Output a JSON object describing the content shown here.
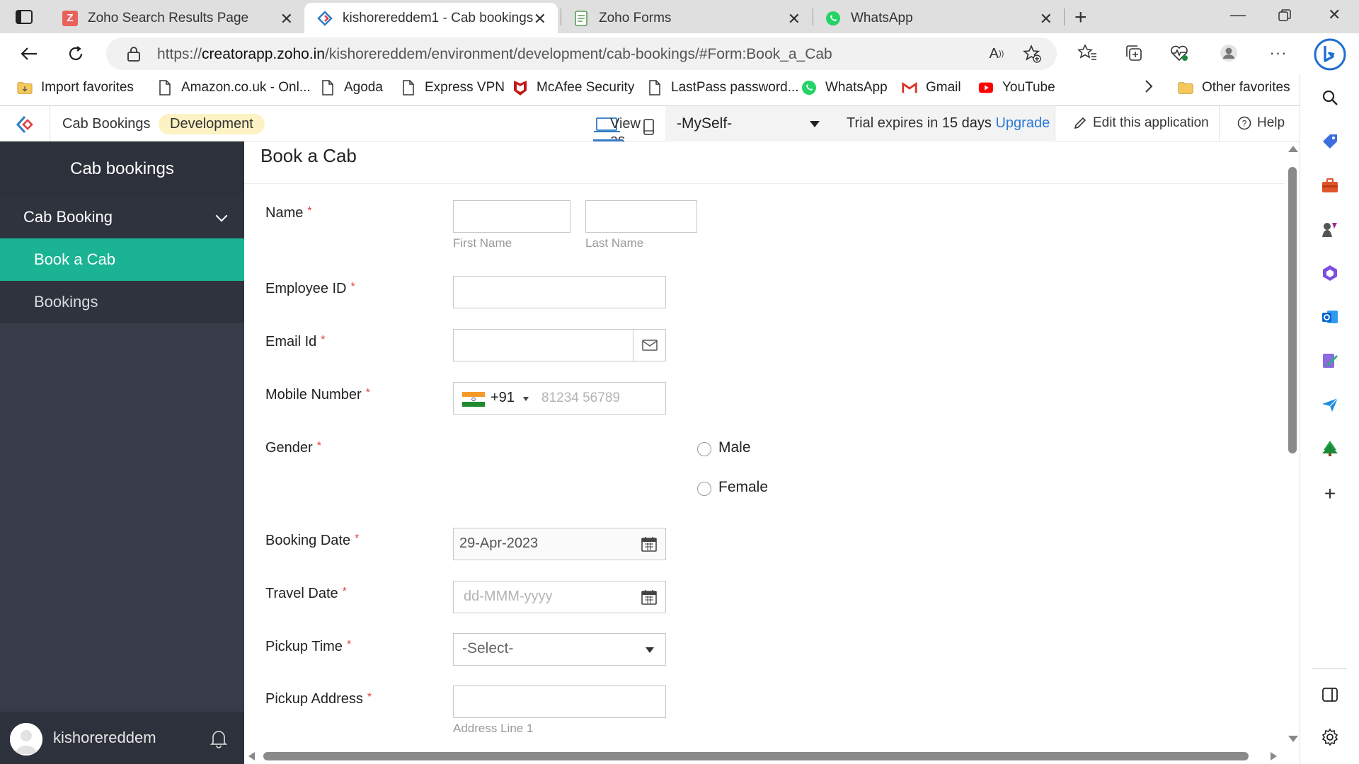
{
  "browser": {
    "tabs": [
      {
        "title": "Zoho Search Results Page",
        "icon": "zoho-z-icon"
      },
      {
        "title": "kishorereddem1 - Cab bookings",
        "icon": "zoho-creator-icon",
        "active": true
      },
      {
        "title": "Zoho Forms",
        "icon": "zoho-forms-icon"
      },
      {
        "title": "WhatsApp",
        "icon": "whatsapp-icon"
      }
    ],
    "url_prefix": "https://",
    "url_domain": "creatorapp.zoho.in",
    "url_path": "/kishorereddem/environment/development/cab-bookings/#Form:Book_a_Cab",
    "favorites": [
      {
        "label": "Import favorites",
        "icon": "folder-import-icon"
      },
      {
        "label": "Amazon.co.uk - Onl...",
        "icon": "page-icon"
      },
      {
        "label": "Agoda",
        "icon": "page-icon"
      },
      {
        "label": "Express VPN",
        "icon": "page-icon"
      },
      {
        "label": "McAfee Security",
        "icon": "mcafee-icon"
      },
      {
        "label": "LastPass password...",
        "icon": "page-icon"
      },
      {
        "label": "WhatsApp",
        "icon": "whatsapp-icon"
      },
      {
        "label": "Gmail",
        "icon": "gmail-icon"
      },
      {
        "label": "YouTube",
        "icon": "youtube-icon"
      }
    ],
    "other_favorites": "Other favorites"
  },
  "app_header": {
    "app_name": "Cab Bookings",
    "environment": "Development",
    "view_as": "View as",
    "view_as_user": "-MySelf-",
    "trial_prefix": "Trial expires in ",
    "trial_days": "15 days",
    "upgrade": "Upgrade",
    "edit_app": "Edit this application",
    "help": "Help"
  },
  "sidebar": {
    "title": "Cab bookings",
    "section": "Cab Booking",
    "items": [
      {
        "label": "Book a Cab",
        "active": true
      },
      {
        "label": "Bookings",
        "active": false
      }
    ],
    "username": "kishorereddem"
  },
  "form": {
    "title": "Book a Cab",
    "fields": {
      "name": {
        "label": "Name",
        "first_sub": "First Name",
        "last_sub": "Last Name",
        "first_value": "",
        "last_value": ""
      },
      "employee_id": {
        "label": "Employee ID",
        "value": ""
      },
      "email": {
        "label": "Email Id",
        "value": ""
      },
      "mobile": {
        "label": "Mobile Number",
        "country_code": "+91",
        "placeholder": "81234 56789"
      },
      "gender": {
        "label": "Gender",
        "options": [
          "Male",
          "Female"
        ]
      },
      "booking_date": {
        "label": "Booking Date",
        "value": "29-Apr-2023"
      },
      "travel_date": {
        "label": "Travel Date",
        "placeholder": "dd-MMM-yyyy"
      },
      "pickup_time": {
        "label": "Pickup Time",
        "value": "-Select-"
      },
      "pickup_address": {
        "label": "Pickup Address",
        "sub": "Address Line 1",
        "value": ""
      }
    }
  },
  "colors": {
    "accent_active_nav": "#1ab394",
    "nav_bg": "#373c48",
    "link": "#2a7ad5",
    "required": "#e0403f"
  }
}
